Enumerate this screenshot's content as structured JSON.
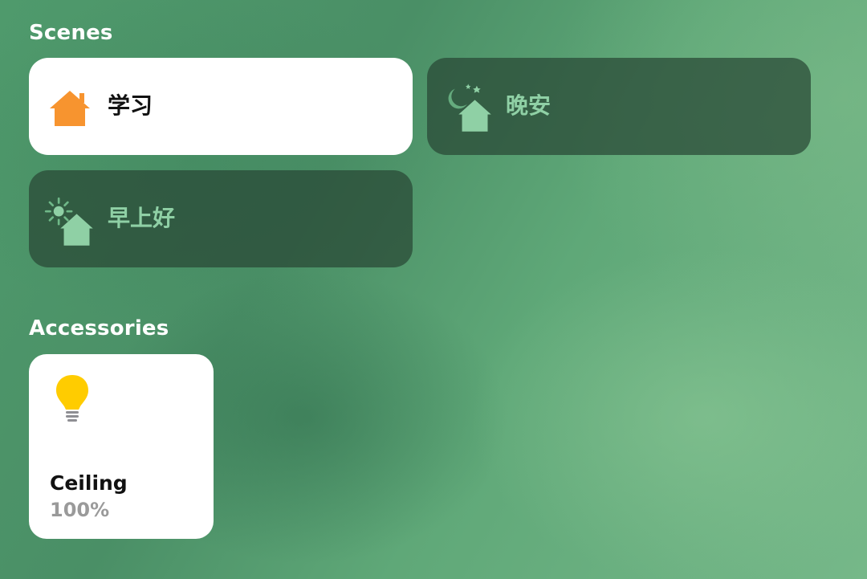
{
  "scenes": {
    "title": "Scenes",
    "items": [
      {
        "label": "学习",
        "icon": "house-icon",
        "active": true,
        "icon_color": "#F7942F"
      },
      {
        "label": "晚安",
        "icon": "house-moon-stars-icon",
        "active": false,
        "icon_color": "#8FD0A5"
      },
      {
        "label": "早上好",
        "icon": "house-sun-icon",
        "active": false,
        "icon_color": "#8FD0A5"
      }
    ]
  },
  "accessories": {
    "title": "Accessories",
    "items": [
      {
        "name": "Ceiling",
        "status": "100%",
        "icon": "lightbulb-icon",
        "icon_color": "#FFCC00"
      }
    ]
  }
}
